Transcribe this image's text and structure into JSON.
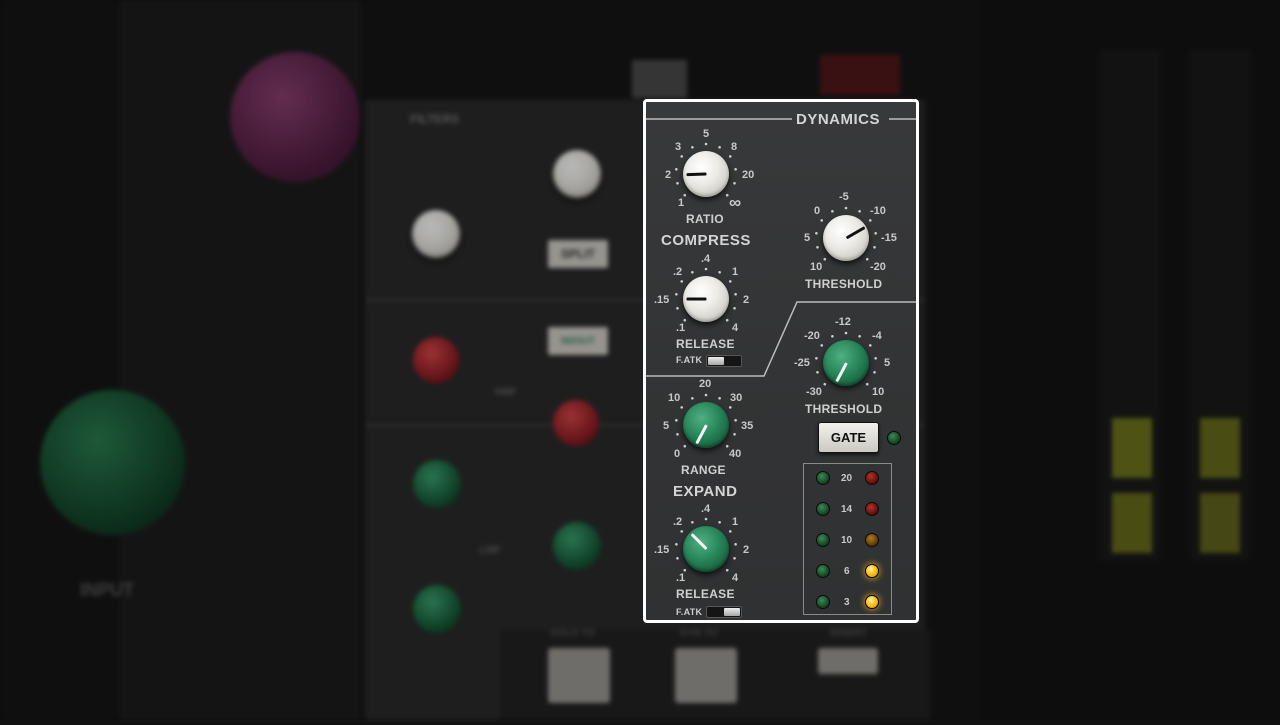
{
  "background": {
    "filters_title": "FILTERS",
    "left_button": "SPLIT",
    "mid_button": "IN/OUT",
    "mid_left_label": "HMF",
    "lower_left_label": "LMF",
    "big_knob_label": "INPUT",
    "bottom_labels": [
      "SOLO TO",
      "DYN TO",
      "INSERT"
    ]
  },
  "dynamics": {
    "title": "DYNAMICS",
    "compress": {
      "section_label": "COMPRESS",
      "ratio": {
        "label": "RATIO",
        "ticks": [
          "1",
          "2",
          "3",
          "5",
          "8",
          "20",
          "∞"
        ]
      },
      "threshold": {
        "label": "THRESHOLD",
        "ticks": [
          "10",
          "5",
          "0",
          "-5",
          "-10",
          "-15",
          "-20"
        ]
      },
      "release": {
        "label": "RELEASE",
        "ticks": [
          ".1",
          ".15",
          ".2",
          ".4",
          "1",
          "2",
          "4"
        ]
      },
      "fast_attack_label": "F.ATK"
    },
    "expand": {
      "section_label": "EXPAND",
      "range": {
        "label": "RANGE",
        "ticks": [
          "0",
          "5",
          "10",
          "20",
          "30",
          "35",
          "40"
        ]
      },
      "threshold": {
        "label": "THRESHOLD",
        "ticks": [
          "-30",
          "-25",
          "-20",
          "-12",
          "-4",
          "5",
          "10"
        ]
      },
      "release": {
        "label": "RELEASE",
        "ticks": [
          ".1",
          ".15",
          ".2",
          ".4",
          "1",
          "2",
          "4"
        ]
      },
      "fast_attack_label": "F.ATK",
      "gate_button": "GATE"
    },
    "meter": {
      "levels": [
        "20",
        "14",
        "10",
        "6",
        "3"
      ],
      "right_led_colors": [
        "red",
        "red",
        "amber",
        "amber-lit",
        "amber-lit"
      ]
    }
  },
  "colors": {
    "knob_white": "#ecebe6",
    "knob_green": "#27855a",
    "focus_border": "#ffffff",
    "led_amber_on": "#ffc21c"
  }
}
